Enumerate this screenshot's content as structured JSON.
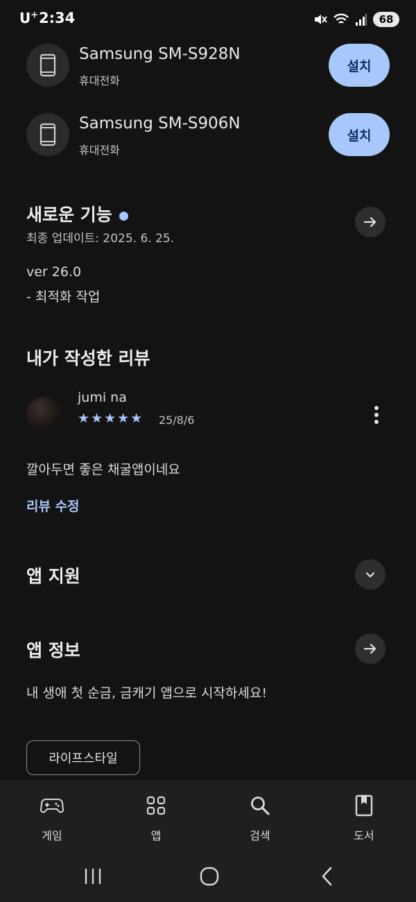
{
  "status_bar": {
    "carrier": "U",
    "carrier_sup": "+",
    "time": "2:34",
    "battery": "68"
  },
  "devices": [
    {
      "name": "Samsung SM-S928N",
      "type": "휴대전화",
      "button": "설치"
    },
    {
      "name": "Samsung SM-S906N",
      "type": "휴대전화",
      "button": "설치"
    }
  ],
  "whats_new": {
    "title": "새로운 기능",
    "last_updated": "최종 업데이트: 2025. 6. 25.",
    "version": "ver 26.0",
    "notes": "- 최적화 작업"
  },
  "my_review": {
    "title": "내가 작성한 리뷰",
    "author": "jumi na",
    "stars": "★★★★★",
    "rating": 5,
    "date": "25/8/6",
    "text": "깔아두면 좋은 채굴앱이네요",
    "edit_label": "리뷰 수정"
  },
  "app_support": {
    "title": "앱 지원"
  },
  "app_info": {
    "title": "앱 정보",
    "description": "내 생애 첫 순금, 금캐기 앱으로 시작하세요!",
    "category_chip": "라이프스타일"
  },
  "bottom_nav": [
    {
      "label": "게임",
      "icon": "gamepad-icon"
    },
    {
      "label": "앱",
      "icon": "apps-grid-icon"
    },
    {
      "label": "검색",
      "icon": "search-icon"
    },
    {
      "label": "도서",
      "icon": "book-icon"
    }
  ],
  "colors": {
    "background": "#131313",
    "accent": "#a8c7fa",
    "button_text": "#0b2e66"
  }
}
